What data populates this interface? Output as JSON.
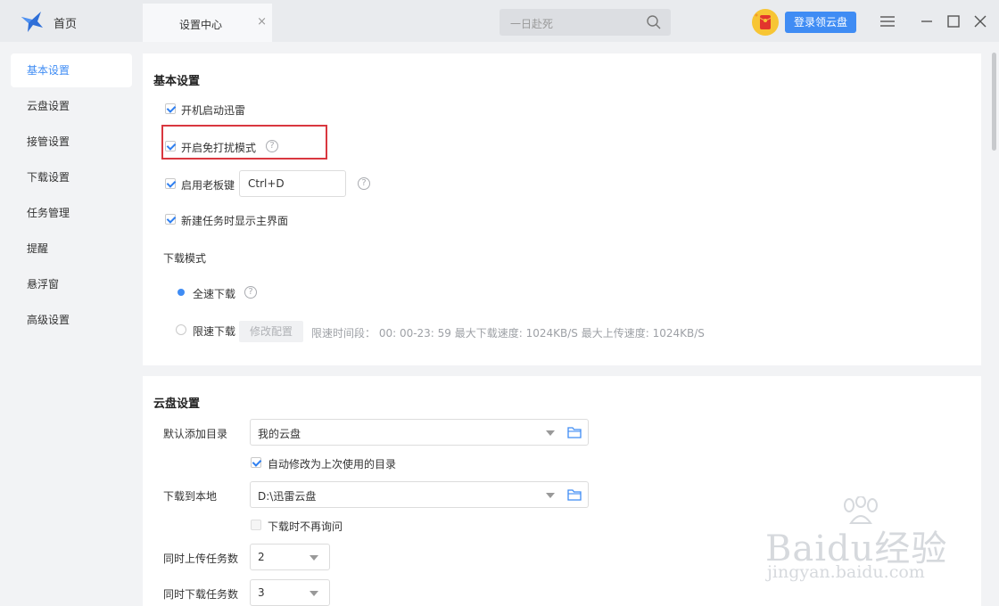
{
  "titlebar": {
    "home_label": "首页",
    "tab_label": "设置中心",
    "tab_close": "×",
    "search_placeholder": "一日赴死",
    "login_label": "登录领云盘"
  },
  "sidebar": {
    "items": [
      {
        "label": "基本设置"
      },
      {
        "label": "云盘设置"
      },
      {
        "label": "接管设置"
      },
      {
        "label": "下载设置"
      },
      {
        "label": "任务管理"
      },
      {
        "label": "提醒"
      },
      {
        "label": "悬浮窗"
      },
      {
        "label": "高级设置"
      }
    ]
  },
  "basic": {
    "title": "基本设置",
    "autostart": "开机启动迅雷",
    "dnd": "开启免打扰模式",
    "boss_key": "启用老板键",
    "boss_key_value": "Ctrl+D",
    "show_main": "新建任务时显示主界面",
    "download_mode": "下载模式",
    "full_speed": "全速下载",
    "limited_speed": "限速下载",
    "modify_config": "修改配置",
    "limit_info": "限速时间段： 00: 00-23: 59   最大下载速度: 1024KB/S    最大上传速度: 1024KB/S",
    "help": "?"
  },
  "cloud": {
    "title": "云盘设置",
    "default_dir_label": "默认添加目录",
    "default_dir_value": "我的云盘",
    "auto_modify": "自动修改为上次使用的目录",
    "download_local_label": "下载到本地",
    "download_local_value": "D:\\迅雷云盘",
    "no_ask": "下载时不再询问",
    "upload_tasks_label": "同时上传任务数",
    "upload_tasks_value": "2",
    "download_tasks_label": "同时下载任务数",
    "download_tasks_value": "3"
  },
  "watermark": {
    "main": "Baidu经验",
    "sub": "jingyan.baidu.com"
  },
  "colors": {
    "accent": "#3f8cf4",
    "highlight_box": "#d9373f"
  }
}
